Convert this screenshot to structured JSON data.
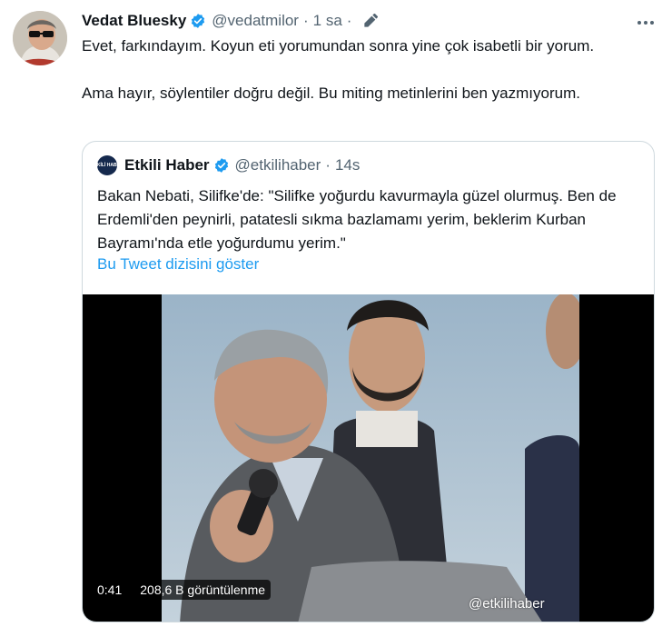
{
  "tweet": {
    "author_name": "Vedat Bluesky",
    "author_handle": "@vedatmilor",
    "separator": "·",
    "time": "1 sa",
    "time_separator": "·",
    "text_line1": "Evet, farkındayım. Koyun eti yorumundan sonra yine çok isabetli bir yorum.",
    "text_line2": "Ama hayır, söylentiler doğru değil. Bu miting metinlerini ben yazmıyorum.",
    "more_icon": "more-horizontal-icon",
    "edit_icon": "pencil-icon"
  },
  "quote": {
    "author_name": "Etkili Haber",
    "author_handle": "@etkilihaber",
    "separator": "·",
    "time": "14s",
    "avatar_text": "ETKİLİ HABER",
    "text": "Bakan Nebati, Silifke'de: \"Silifke yoğurdu kavurmayla güzel olurmuş. Ben de Erdemli'den peynirli, patatesli sıkma bazlamamı yerim, beklerim Kurban Bayramı'nda etle yoğurdumu yerim.\"",
    "thread_link": "Bu Tweet dizisini göster",
    "video": {
      "duration": "0:41",
      "views": "208,6 B görüntülenme",
      "watermark": "@etkilihaber"
    }
  },
  "colors": {
    "text": "#0f1419",
    "muted": "#536471",
    "link": "#1d9bf0",
    "verified": "#1d9bf0",
    "border": "#cfd9de"
  }
}
